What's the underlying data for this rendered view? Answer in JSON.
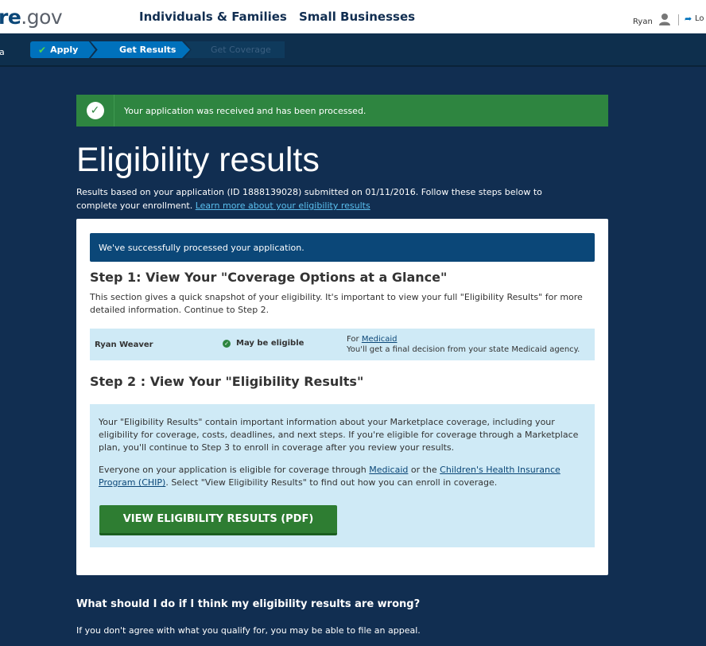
{
  "header": {
    "logo_part1": "re",
    "logo_part2": ".gov",
    "nav": [
      "Individuals & Families",
      "Small Businesses"
    ],
    "user_name": "Ryan",
    "logout_label": "Lo"
  },
  "progress": {
    "state_label": "ia",
    "steps": [
      "Apply",
      "Get Results",
      "Get Coverage"
    ]
  },
  "banner": {
    "text": "Your application was received and has been processed."
  },
  "page": {
    "title": "Eligibility results",
    "intro": "Results based on your application (ID 1888139028) submitted on 01/11/2016. Follow these steps below to complete your enrollment.",
    "intro_link": "Learn more about your eligibility results"
  },
  "card": {
    "processed_notice": "We've successfully processed your application.",
    "step1_title": "Step 1: View Your \"Coverage Options at a Glance\"",
    "step1_desc": "This section gives a quick snapshot of your eligibility. It's important to view your full \"Eligibility Results\" for more detailed information. Continue to Step 2.",
    "glance": {
      "name": "Ryan Weaver",
      "status": "May be eligible",
      "for_prefix": "For ",
      "for_link": "Medicaid",
      "note": "You'll get a final decision from your state Medicaid agency."
    },
    "step2_title": "Step 2 : View Your \"Eligibility Results\"",
    "results_p1": "Your \"Eligibility Results\" contain important information about your Marketplace coverage, including your eligibility for coverage, costs, deadlines, and next steps. If you're eligible for coverage through a Marketplace plan, you'll continue to Step 3 to enroll in coverage after you review your results.",
    "results_p2_a": "Everyone on your application is eligible for coverage through ",
    "results_p2_link1": "Medicaid",
    "results_p2_b": " or the ",
    "results_p2_link2": "Children's Health Insurance Program (CHIP)",
    "results_p2_c": ". Select \"View Eligibility Results\" to find out how you can enroll in coverage.",
    "view_button": "VIEW ELIGIBILITY RESULTS (PDF)"
  },
  "faq": {
    "question": "What should I do if I think my eligibility results are wrong?",
    "answer": "If you don't agree with what you qualify for, you may be able to file an appeal."
  },
  "colors": {
    "background": "#112e51",
    "success_green": "#2e8540",
    "primary_blue": "#0071bc",
    "light_blue_panel": "#cfeaf6"
  }
}
